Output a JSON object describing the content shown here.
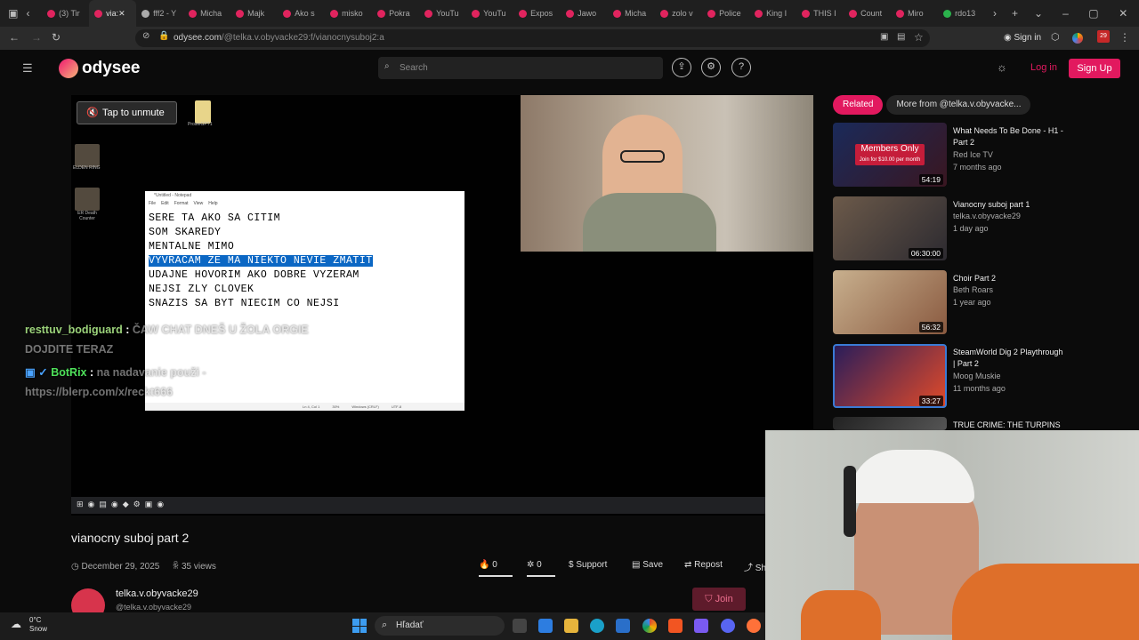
{
  "browser": {
    "tabs": [
      {
        "label": "(3) Tir",
        "color": "#e0245e"
      },
      {
        "label": "via:",
        "color": "#e0245e",
        "active": true
      },
      {
        "label": "fff2 - Y",
        "color": "#aaa"
      },
      {
        "label": "Micha",
        "color": "#e0245e"
      },
      {
        "label": "Majk",
        "color": "#e0245e"
      },
      {
        "label": "Ako s",
        "color": "#e0245e"
      },
      {
        "label": "misko",
        "color": "#e0245e"
      },
      {
        "label": "Pokra",
        "color": "#e0245e"
      },
      {
        "label": "YouTu",
        "color": "#e0245e"
      },
      {
        "label": "YouTu",
        "color": "#e0245e"
      },
      {
        "label": "Expos",
        "color": "#e0245e"
      },
      {
        "label": "Jawo",
        "color": "#e0245e"
      },
      {
        "label": "Micha",
        "color": "#e0245e"
      },
      {
        "label": "zolo v",
        "color": "#e0245e"
      },
      {
        "label": "Police",
        "color": "#e0245e"
      },
      {
        "label": "King I",
        "color": "#e0245e"
      },
      {
        "label": "THIS I",
        "color": "#e0245e"
      },
      {
        "label": "Count",
        "color": "#e0245e"
      },
      {
        "label": "Miro",
        "color": "#e0245e"
      },
      {
        "label": "rdo13",
        "color": "#2bb24c"
      }
    ],
    "url_host": "odysee.com",
    "url_path": "/@telka.v.obyvacke29:f/vianocnysuboj2:a",
    "sign_in": "Sign in",
    "ext_badge": "29"
  },
  "site": {
    "logo_text": "odysee",
    "search_placeholder": "Search",
    "login": "Log in",
    "signup": "Sign Up",
    "accent": "#e2195f"
  },
  "video": {
    "unmute_label": "Tap to unmute",
    "desktop_icons": [
      "ProsteGPT1",
      "ELDEN RING",
      "ER Death Counter"
    ],
    "notepad": {
      "title": "*Untitled - Notepad",
      "menu": [
        "File",
        "Edit",
        "Format",
        "View",
        "Help"
      ],
      "lines": [
        "SERE TA AKO SA CITIM",
        "SOM SKAREDY",
        "MENTALNE MIMO",
        "VYVRACAM ZE MA NIEKTO NEVIE ZMATIT",
        "UDAJNE HOVORIM AKO DOBRE VYZERAM",
        "NEJSI ZLY CLOVEK",
        "SNAZIS SA BYT NIECIM CO NEJSI"
      ],
      "selected_line": 3,
      "status": [
        "Ln 4, Col 1",
        "30%",
        "Windows (CRLF)",
        "UTF-8"
      ]
    },
    "chat": [
      {
        "user": "resttuv_bodiguard",
        "text": "ČAW CHAT DNEŠ U ŽOLA ORGIE DOJDITE TERAZ"
      },
      {
        "user": "BotRix",
        "text": "na nadavanie použi - https://blerp.com/x/reckt666"
      }
    ],
    "title": "vianocny suboj part 2",
    "date": "December 29, 2025",
    "views": "35 views",
    "actions": {
      "fire": "0",
      "slime": "0",
      "support": "Support",
      "save": "Save",
      "repost": "Repost",
      "share": "Sh"
    },
    "channel": {
      "name": "telka.v.obyvacke29",
      "handle": "@telka.v.obyvacke29",
      "join": "Join"
    }
  },
  "related": {
    "tabs": [
      "Related",
      "More from @telka.v.obyvacke..."
    ],
    "items": [
      {
        "title": "What Needs To Be Done - H1 - Part 2",
        "channel": "Red Ice TV",
        "age": "7 months ago",
        "duration": "54:19",
        "badge": "Members Only",
        "badge_sub": "Join for $10.00 per month"
      },
      {
        "title": "Vianocny suboj part 1",
        "channel": "telka.v.obyvacke29",
        "age": "1 day ago",
        "duration": "06:30:00"
      },
      {
        "title": "Choir Part 2",
        "channel": "Beth Roars",
        "age": "1 year ago",
        "duration": "56:32"
      },
      {
        "title": "SteamWorld Dig 2 Playthrough | Part 2",
        "channel": "Moog Muskie",
        "age": "11 months ago",
        "duration": "33:27"
      },
      {
        "title": "TRUE CRIME: THE TURPINS",
        "channel": "",
        "age": "",
        "duration": ""
      }
    ]
  },
  "os": {
    "search_label": "Hľadať",
    "weather_temp": "0°C",
    "weather_desc": "Snow"
  }
}
